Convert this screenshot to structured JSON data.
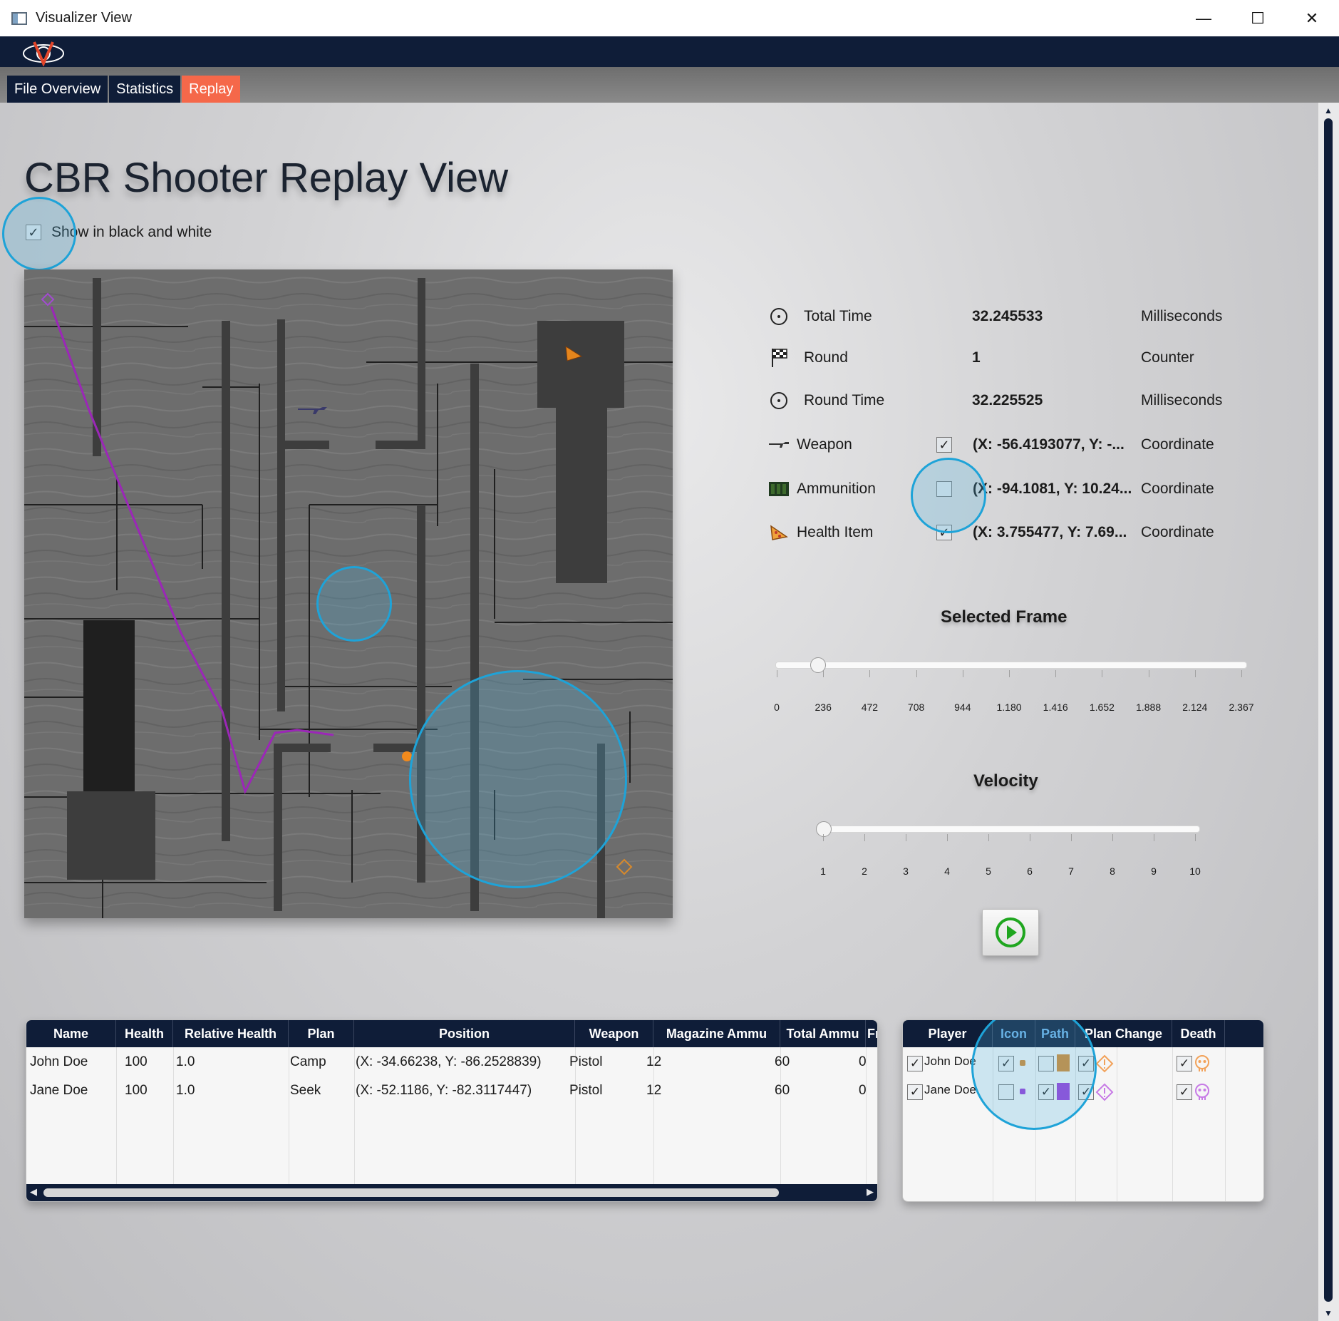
{
  "window": {
    "title": "Visualizer View",
    "minimize": "—",
    "maximize": "☐",
    "close": "✕"
  },
  "tabs": [
    {
      "label": "File Overview",
      "active": false
    },
    {
      "label": "Statistics",
      "active": false
    },
    {
      "label": "Replay",
      "active": true
    }
  ],
  "page": {
    "title": "CBR Shooter Replay View",
    "bw_checkbox": {
      "label": "Show in black and white",
      "checked": true
    }
  },
  "info": {
    "total_time": {
      "label": "Total Time",
      "value": "32.245533",
      "unit": "Milliseconds",
      "icon": "clock-icon"
    },
    "round": {
      "label": "Round",
      "value": "1",
      "unit": "Counter",
      "icon": "checkered-flag-icon"
    },
    "round_time": {
      "label": "Round Time",
      "value": "32.225525",
      "unit": "Milliseconds",
      "icon": "clock-icon"
    },
    "weapon": {
      "label": "Weapon",
      "checked": true,
      "value": "(X: -56.4193077, Y: -...",
      "unit": "Coordinate",
      "icon": "rifle-icon"
    },
    "ammunition": {
      "label": "Ammunition",
      "checked": false,
      "value": "(X: -94.1081, Y: 10.24...",
      "unit": "Coordinate",
      "icon": "ammo-box-icon"
    },
    "health_item": {
      "label": "Health Item",
      "checked": true,
      "value": "(X: 3.755477, Y: 7.69...",
      "unit": "Coordinate",
      "icon": "pizza-icon"
    }
  },
  "selected_frame": {
    "title": "Selected Frame",
    "ticks": [
      "0",
      "236",
      "472",
      "708",
      "944",
      "1.180",
      "1.416",
      "1.652",
      "1.888",
      "2.124",
      "2.367"
    ],
    "value_fraction": 0.088
  },
  "velocity": {
    "title": "Velocity",
    "ticks": [
      "1",
      "2",
      "3",
      "4",
      "5",
      "6",
      "7",
      "8",
      "9",
      "10"
    ],
    "value": 1
  },
  "players_table": {
    "columns": [
      "Name",
      "Health",
      "Relative Health",
      "Plan",
      "Position",
      "Weapon",
      "Magazine Ammu",
      "Total Ammu",
      "Fr"
    ],
    "rows": [
      [
        "John Doe",
        "100",
        "1.0",
        "Camp",
        "(X: -34.66238, Y: -86.2528839)",
        "Pistol",
        "12",
        "60",
        "0"
      ],
      [
        "Jane Doe",
        "100",
        "1.0",
        "Seek",
        "(X: -52.1186, Y: -82.3117447)",
        "Pistol",
        "12",
        "60",
        "0"
      ]
    ]
  },
  "legend_table": {
    "columns": [
      "Player",
      "Icon",
      "Path",
      "Plan Change",
      "Death"
    ],
    "rows": [
      {
        "player": "John Doe",
        "player_checked": true,
        "icon_checked": true,
        "path_checked": false,
        "plan_checked": true,
        "death_checked": true,
        "color": "#d7892c"
      },
      {
        "player": "Jane Doe",
        "player_checked": true,
        "icon_checked": false,
        "path_checked": true,
        "plan_checked": true,
        "death_checked": true,
        "color": "#9a3bd8"
      }
    ]
  },
  "colors": {
    "accent_tab": "#f5684a",
    "navy": "#0f1d38",
    "highlight": "#1ea3d8",
    "play": "#1fa61f"
  }
}
